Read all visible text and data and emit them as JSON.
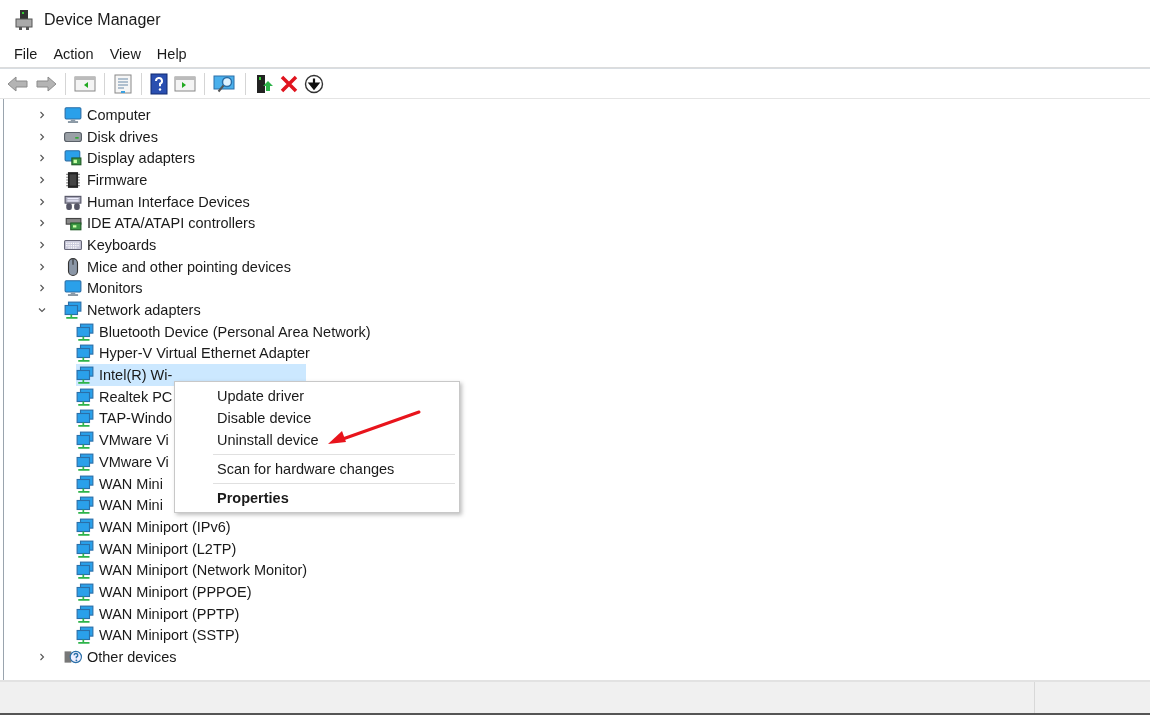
{
  "window": {
    "title": "Device Manager"
  },
  "menu_bar": [
    "File",
    "Action",
    "View",
    "Help"
  ],
  "toolbar": [
    [
      {
        "kind": "back",
        "disabled": true
      },
      {
        "kind": "forward",
        "disabled": true
      }
    ],
    [
      {
        "kind": "console-tree",
        "disabled": false
      }
    ],
    [
      {
        "kind": "properties",
        "disabled": false
      }
    ],
    [
      {
        "kind": "help",
        "disabled": false
      },
      {
        "kind": "action-pane",
        "disabled": false
      }
    ],
    [
      {
        "kind": "scan",
        "disabled": false
      }
    ],
    [
      {
        "kind": "update",
        "disabled": false
      },
      {
        "kind": "uninstall",
        "disabled": false
      },
      {
        "kind": "download",
        "disabled": false
      }
    ]
  ],
  "tree": [
    {
      "label": "Computer",
      "kind": "computer",
      "expanded": false,
      "selected": false
    },
    {
      "label": "Disk drives",
      "kind": "disk",
      "expanded": false,
      "selected": false
    },
    {
      "label": "Display adapters",
      "kind": "display",
      "expanded": false,
      "selected": false
    },
    {
      "label": "Firmware",
      "kind": "firmware",
      "expanded": false,
      "selected": false
    },
    {
      "label": "Human Interface Devices",
      "kind": "hid",
      "expanded": false,
      "selected": false
    },
    {
      "label": "IDE ATA/ATAPI controllers",
      "kind": "ide",
      "expanded": false,
      "selected": false
    },
    {
      "label": "Keyboards",
      "kind": "keyboard",
      "expanded": false,
      "selected": false
    },
    {
      "label": "Mice and other pointing devices",
      "kind": "mouse",
      "expanded": false,
      "selected": false
    },
    {
      "label": "Monitors",
      "kind": "monitor",
      "expanded": false,
      "selected": false
    },
    {
      "label": "Network adapters",
      "kind": "network",
      "expanded": true,
      "selected": false,
      "children": [
        {
          "label": "Bluetooth Device (Personal Area Network)",
          "kind": "network",
          "selected": false
        },
        {
          "label": "Hyper-V Virtual Ethernet Adapter",
          "kind": "network",
          "selected": false
        },
        {
          "label": "Intel(R) Wi-",
          "kind": "network",
          "selected": true
        },
        {
          "label": "Realtek PC",
          "kind": "network",
          "selected": false
        },
        {
          "label": "TAP-Windo",
          "kind": "network",
          "selected": false
        },
        {
          "label": "VMware Vi",
          "kind": "network",
          "selected": false
        },
        {
          "label": "VMware Vi",
          "kind": "network",
          "selected": false
        },
        {
          "label": "WAN Mini",
          "kind": "network",
          "selected": false
        },
        {
          "label": "WAN Mini",
          "kind": "network",
          "selected": false
        },
        {
          "label": "WAN Miniport (IPv6)",
          "kind": "network",
          "selected": false
        },
        {
          "label": "WAN Miniport (L2TP)",
          "kind": "network",
          "selected": false
        },
        {
          "label": "WAN Miniport (Network Monitor)",
          "kind": "network",
          "selected": false
        },
        {
          "label": "WAN Miniport (PPPOE)",
          "kind": "network",
          "selected": false
        },
        {
          "label": "WAN Miniport (PPTP)",
          "kind": "network",
          "selected": false
        },
        {
          "label": "WAN Miniport (SSTP)",
          "kind": "network",
          "selected": false
        }
      ]
    },
    {
      "label": "Other devices",
      "kind": "unknown",
      "expanded": false,
      "selected": false
    }
  ],
  "context_menu": [
    [
      {
        "label": "Update driver",
        "default": false
      },
      {
        "label": "Disable device",
        "default": false
      },
      {
        "label": "Uninstall device",
        "default": false
      }
    ],
    [
      {
        "label": "Scan for hardware changes",
        "default": false
      }
    ],
    [
      {
        "label": "Properties",
        "default": true
      }
    ]
  ]
}
